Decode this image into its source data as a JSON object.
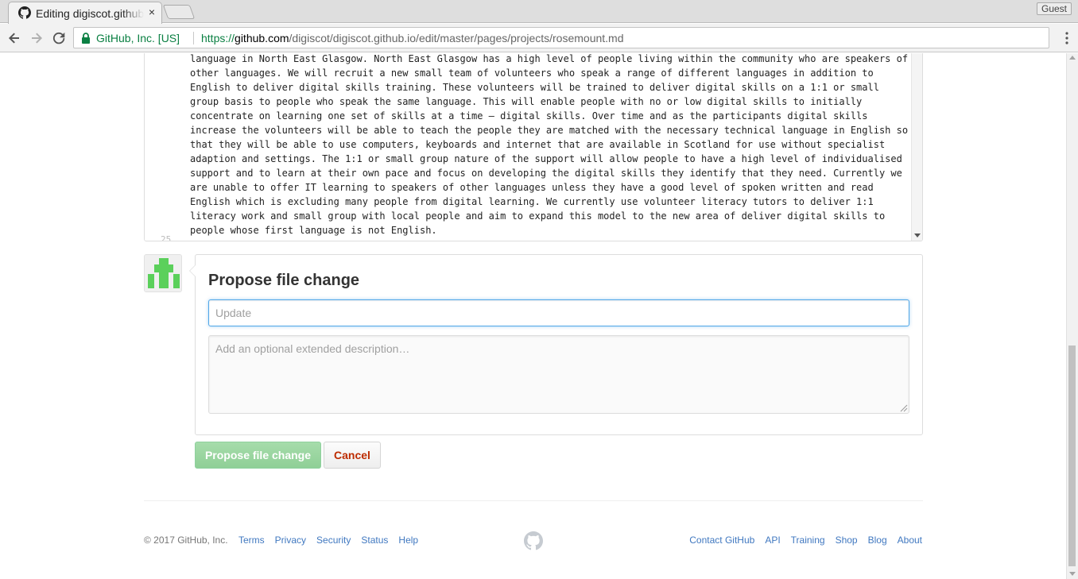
{
  "browser": {
    "tab_title": "Editing digiscot.github.io/pages/projects/rosemount.md",
    "tab_close": "×",
    "guest_label": "Guest",
    "security_label": "GitHub, Inc. [US]",
    "url_scheme": "https://",
    "url_host": "github.com",
    "url_path": "/digiscot/digiscot.github.io/edit/master/pages/projects/rosemount.md"
  },
  "editor": {
    "lines": [
      "language in North East Glasgow. North East Glasgow has a high level of people living within the community who are speakers of",
      "other languages. We will recruit a new small team of volunteers who speak a range of different languages in addition to",
      "English to deliver digital skills training. These volunteers will be trained to deliver digital skills on a 1:1 or small",
      "group basis to people who speak the same language. This will enable people with no or low digital skills to initially",
      "concentrate on learning one set of skills at a time – digital skills. Over time and as the participants digital skills",
      "increase the volunteers will be able to teach the people they are matched with the necessary technical language in English so",
      "that they will be able to use computers, keyboards and internet that are available in Scotland for use without specialist",
      "adaption and settings. The 1:1 or small group nature of the support will allow people to have a high level of individualised",
      "support and to learn at their own pace and focus on developing the digital skills they identify that they need. Currently we",
      "are unable to offer IT learning to speakers of other languages unless they have a good level of spoken written and read",
      "English which is excluding many people from digital learning. We currently use volunteer literacy tutors to deliver 1:1",
      "literacy work and small group with local people and aim to expand this model to the new area of deliver digital skills to",
      "people whose first language is not English."
    ],
    "next_line_number": "25"
  },
  "commit": {
    "heading": "Propose file change",
    "summary_placeholder": "Update",
    "summary_value": "",
    "description_placeholder": "Add an optional extended description…",
    "submit_label": "Propose file change",
    "cancel_label": "Cancel"
  },
  "footer": {
    "copyright": "© 2017 GitHub, Inc.",
    "left_links": [
      "Terms",
      "Privacy",
      "Security",
      "Status",
      "Help"
    ],
    "right_links": [
      "Contact GitHub",
      "API",
      "Training",
      "Shop",
      "Blog",
      "About"
    ]
  },
  "colors": {
    "link": "#4078c0",
    "submit_disabled": "#94d3a2",
    "cancel_text": "#bd2c00",
    "secure_green": "#0b8043",
    "avatar_green": "#5bd05b"
  }
}
